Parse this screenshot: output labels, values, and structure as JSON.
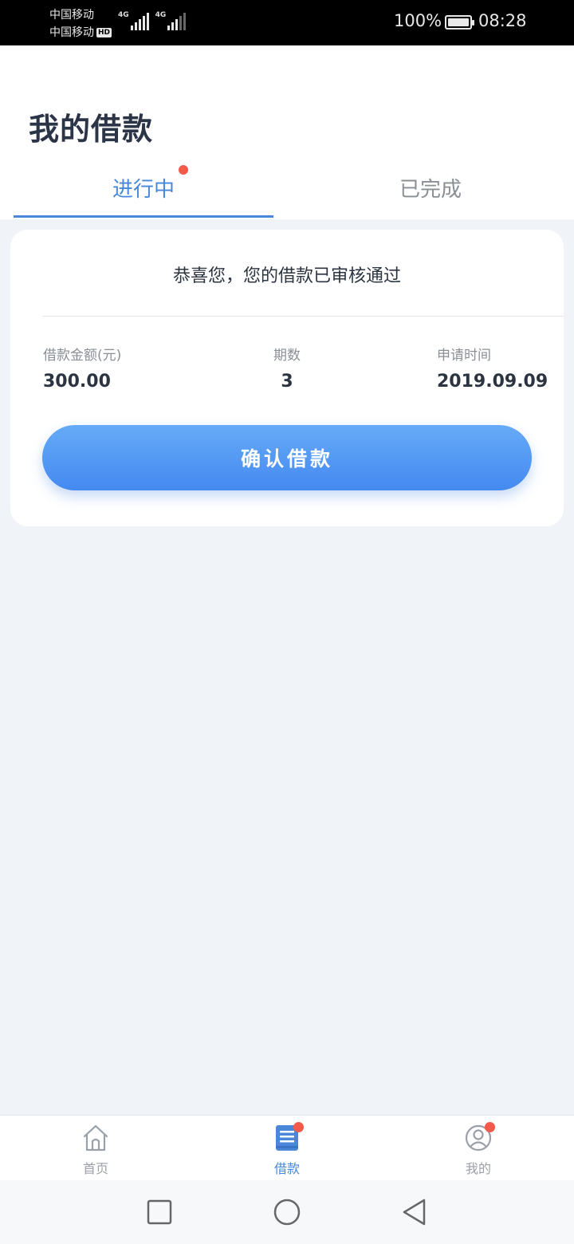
{
  "status_bar": {
    "carrier1": "中国移动",
    "carrier2": "中国移动",
    "hd_badge": "HD",
    "network1": "4G",
    "network2": "4G",
    "battery": "100%",
    "time": "08:28"
  },
  "header": {
    "title": "我的借款",
    "tabs": [
      {
        "label": "进行中",
        "active": true,
        "has_badge": true
      },
      {
        "label": "已完成",
        "active": false,
        "has_badge": false
      }
    ]
  },
  "loan_card": {
    "message": "恭喜您，您的借款已审核通过",
    "amount_label": "借款金额(元)",
    "amount_value": "300.00",
    "periods_label": "期数",
    "periods_value": "3",
    "date_label": "申请时间",
    "date_value": "2019.09.09",
    "confirm_button": "确认借款"
  },
  "bottom_nav": {
    "items": [
      {
        "label": "首页",
        "icon": "home-icon",
        "active": false,
        "badge": false
      },
      {
        "label": "借款",
        "icon": "loan-document-icon",
        "active": true,
        "badge": true
      },
      {
        "label": "我的",
        "icon": "user-profile-icon",
        "active": false,
        "badge": true
      }
    ]
  },
  "colors": {
    "accent": "#4a87d9",
    "badge": "#f25a4a",
    "page_background": "#f0f4f8",
    "button_gradient_top": "#66abf8",
    "button_gradient_bottom": "#4489f0"
  }
}
